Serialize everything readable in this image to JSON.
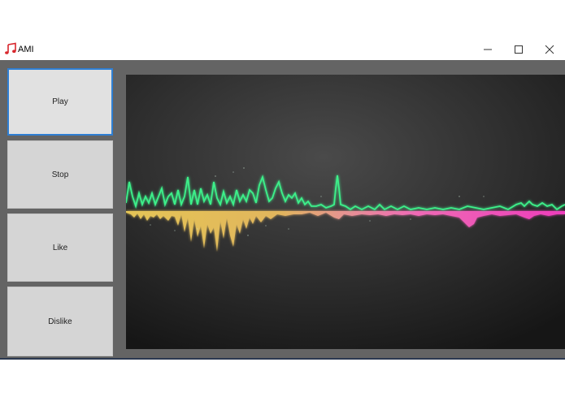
{
  "window": {
    "title": "AMI",
    "icon": "music-note-icon",
    "controls": [
      "minimize-icon",
      "maximize-icon",
      "close-icon"
    ]
  },
  "buttons": {
    "play": "Play",
    "stop": "Stop",
    "like": "Like",
    "dislike": "Dislike"
  },
  "colors": {
    "panel_bg": "#646464",
    "focus_border": "#2f7fd3",
    "wave_green": "#3cf08a",
    "wave_yellow": "#f5d35a",
    "wave_pink": "#ff4fc8",
    "icon_red": "#d8262c"
  }
}
